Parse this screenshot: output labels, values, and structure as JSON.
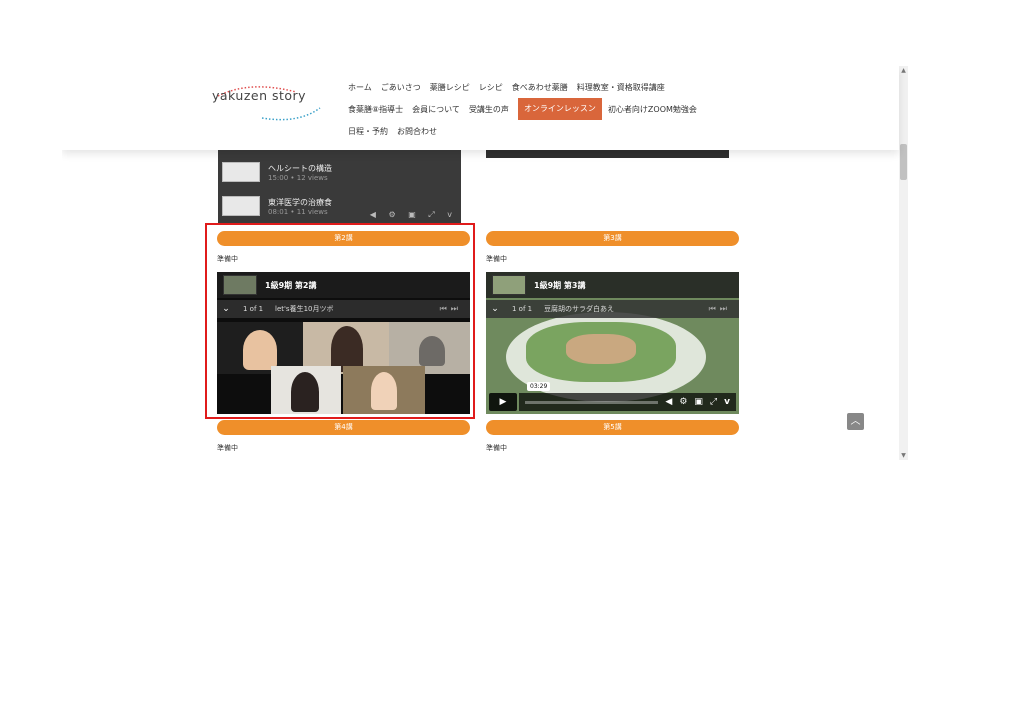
{
  "header": {
    "logo_text": "yakuzen story",
    "nav_row1": [
      "ホーム",
      "ごあいさつ",
      "薬膳レシピ",
      "レシピ",
      "食べあわせ薬膳",
      "料理教室・資格取得講座"
    ],
    "nav_row2": [
      "食薬膳⑧指導士",
      "会員について",
      "受講生の声",
      "オンラインレッスン",
      "初心者向けZOOM勉強会"
    ],
    "nav_row3": [
      "日程・予約",
      "お問合わせ"
    ],
    "active_item": "オンラインレッスン"
  },
  "top_left_video": {
    "playlist": [
      {
        "title": "ヘルシートの構造",
        "meta": "15:00 • 12 views"
      },
      {
        "title": "東洋医学の治療食",
        "meta": "08:01 • 11 views"
      }
    ]
  },
  "cards": [
    {
      "pill": "第2講",
      "status": "準備中",
      "video_title": "1級9期 第2講",
      "counter": "1 of 1",
      "item": "let's養生10月ツボ"
    },
    {
      "pill": "第3講",
      "status": "準備中",
      "video_title": "1級9期 第3講",
      "counter": "1 of 1",
      "item": "豆腐胡のサラダ白あえ",
      "time": "03:29"
    }
  ],
  "bottom_cards": [
    {
      "pill": "第4講",
      "status": "準備中"
    },
    {
      "pill": "第5講",
      "status": "準備中"
    }
  ],
  "icons": {
    "play": "play-icon",
    "volume": "volume-icon",
    "settings": "gear-icon",
    "pip": "pip-icon",
    "fullscreen": "fullscreen-icon",
    "vimeo": "vimeo-icon",
    "back_to_top": "chevron-up-icon"
  },
  "colors": {
    "accent_orange": "#ef8f2a",
    "nav_active": "#d9663b",
    "highlight_red": "#e01b1b"
  }
}
